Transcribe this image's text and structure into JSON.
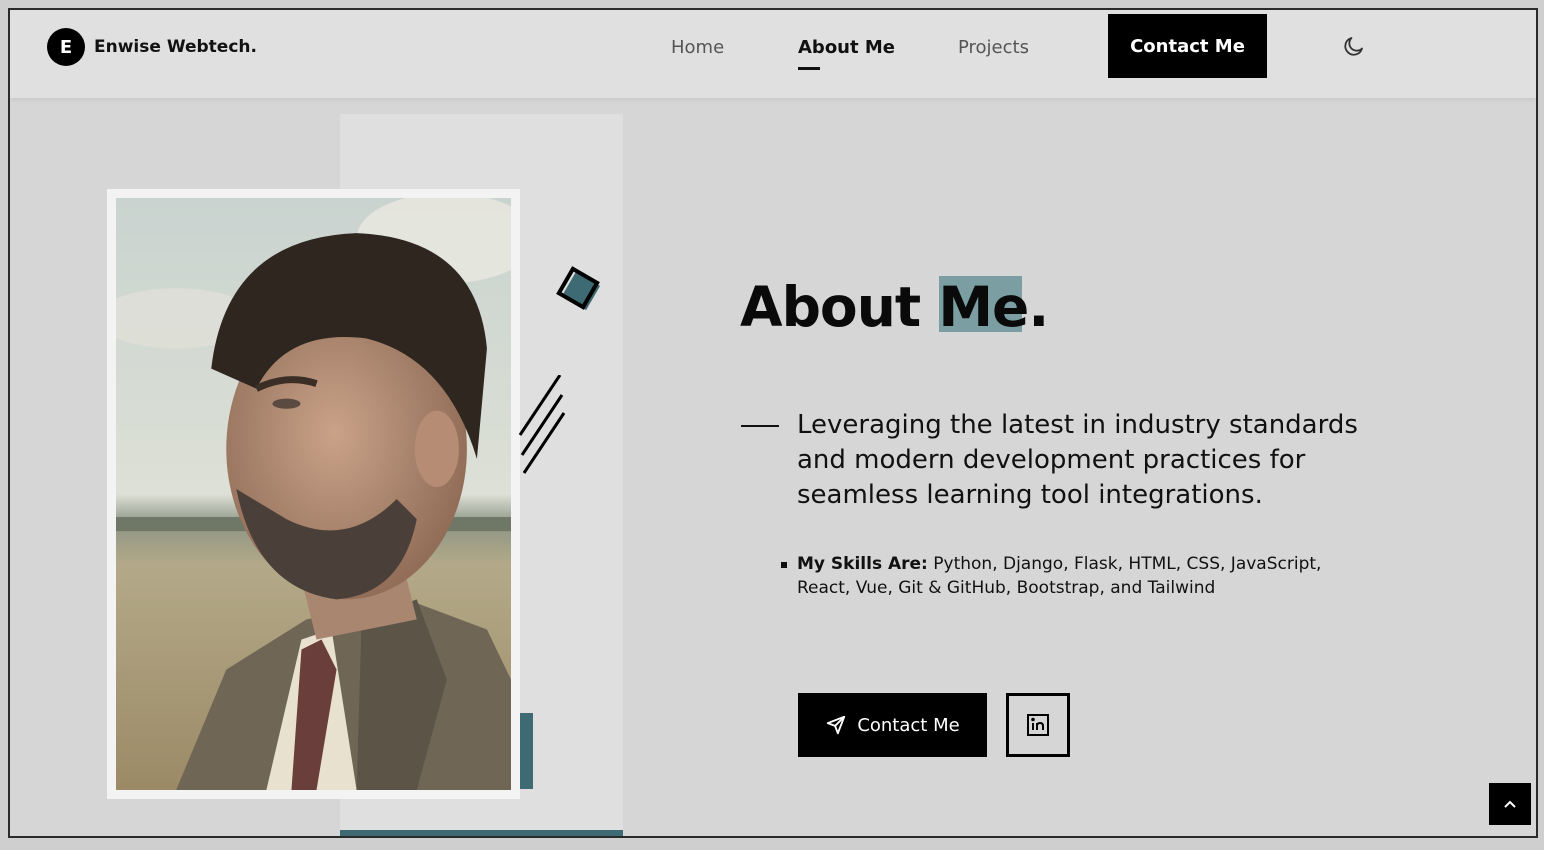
{
  "header": {
    "logo_letter": "E",
    "brand_name": "Enwise Webtech.",
    "nav": [
      {
        "label": "Home"
      },
      {
        "label": "About Me"
      },
      {
        "label": "Projects"
      }
    ],
    "cta_label": "Contact Me",
    "theme_icon": "moon-icon"
  },
  "about": {
    "title": "About Me.",
    "intro": "Leveraging the latest in industry standards and modern development practices for seamless learning tool integrations.",
    "skills_label": "My Skills Are:",
    "skills_text": " Python, Django, Flask, HTML, CSS, JavaScript, React, Vue, Git & GitHub, Bootstrap, and Tailwind",
    "contact_button": "Contact Me",
    "contact_icon": "send-icon",
    "linkedin_icon": "linkedin-icon"
  },
  "scroll_top_icon": "chevron-up-icon",
  "colors": {
    "accent_teal": "#3d6a73",
    "title_highlight": "#7a9ea1",
    "primary": "#000000",
    "background": "#d6d6d6"
  }
}
